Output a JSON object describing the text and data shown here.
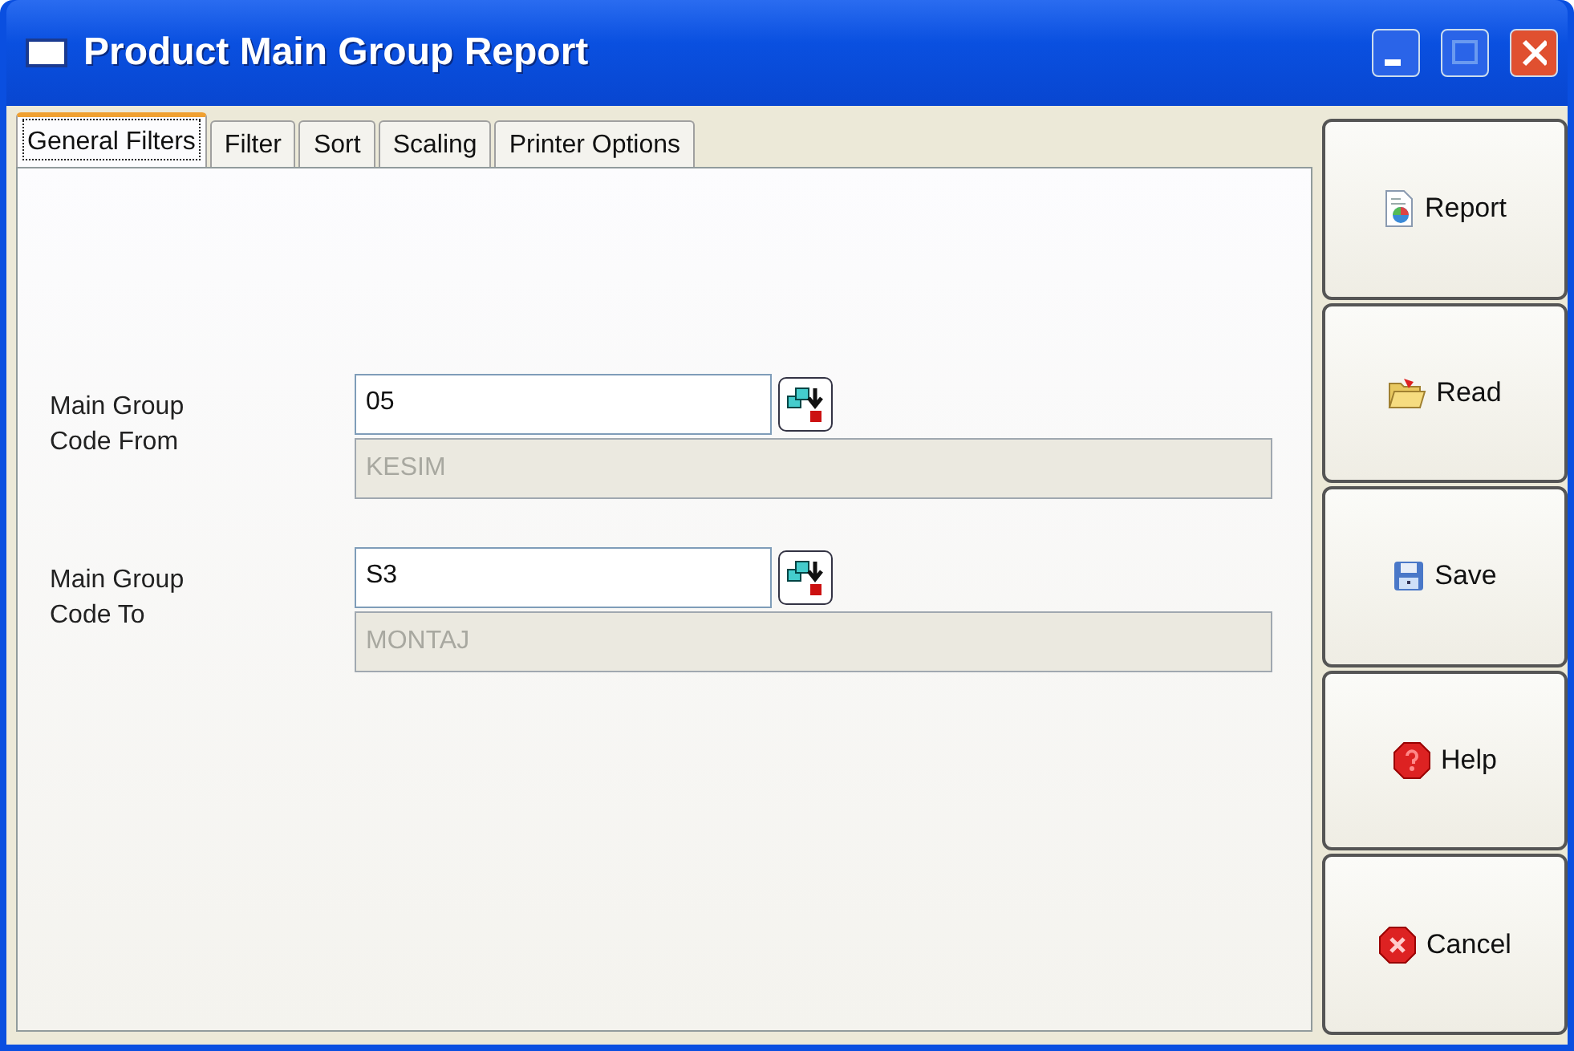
{
  "window": {
    "title": "Product Main Group Report"
  },
  "tabs": [
    {
      "label": "General Filters",
      "selected": true
    },
    {
      "label": "Filter",
      "selected": false
    },
    {
      "label": "Sort",
      "selected": false
    },
    {
      "label": "Scaling",
      "selected": false
    },
    {
      "label": "Printer Options",
      "selected": false
    }
  ],
  "filters": [
    {
      "label": "Main Group Code From",
      "value": "05",
      "description": "KESIM"
    },
    {
      "label": "Main Group Code To",
      "value": "S3",
      "description": "MONTAJ"
    }
  ],
  "buttons": [
    {
      "kind": "report",
      "label": "Report"
    },
    {
      "kind": "read",
      "label": "Read"
    },
    {
      "kind": "save",
      "label": "Save"
    },
    {
      "kind": "help",
      "label": "Help"
    },
    {
      "kind": "cancel",
      "label": "Cancel"
    }
  ]
}
